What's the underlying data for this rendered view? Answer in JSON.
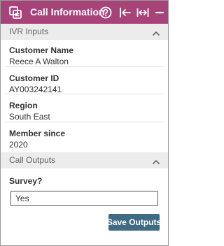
{
  "window": {
    "title": "Call Information",
    "accent_color": "#a8437a",
    "icons": [
      "app-logo-icon",
      "help-icon",
      "dock-icon",
      "expand-icon",
      "minimize-icon"
    ]
  },
  "ivr_inputs": {
    "header": "IVR Inputs",
    "fields": [
      {
        "label": "Customer Name",
        "value": "Reece A Walton"
      },
      {
        "label": "Customer ID",
        "value": "AY003242141"
      },
      {
        "label": "Region",
        "value": "South East"
      },
      {
        "label": "Member since",
        "value": "2020"
      }
    ]
  },
  "call_outputs": {
    "header": "Call Outputs",
    "survey_label": "Survey?",
    "survey_value": "Yes",
    "save_label": "Save Outputs",
    "save_color": "#3f6b84"
  }
}
